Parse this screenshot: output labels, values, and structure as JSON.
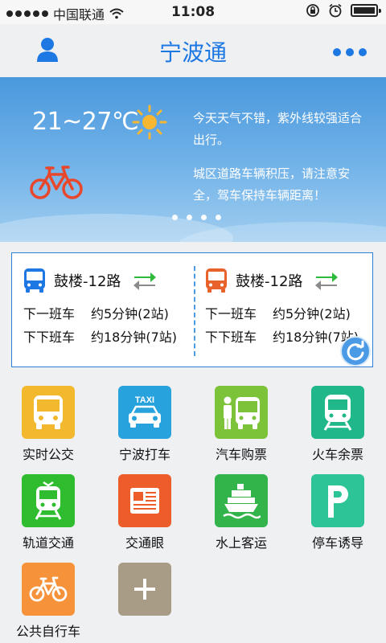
{
  "status_bar": {
    "carrier": "中国联通",
    "time": "11:08"
  },
  "header": {
    "title": "宁波通",
    "user_icon": "user-icon",
    "more_icon": "more-dots-icon"
  },
  "banner": {
    "temperature": "21~27℃",
    "weather_icon": "sun-icon",
    "transport_icon": "bicycle-icon",
    "notice_weather": "今天天气不错，紫外线较强适合出行。",
    "notice_traffic": "城区道路车辆积压，请注意安全，驾车保持车辆距离！",
    "page_count": 4,
    "active_page": 1
  },
  "bus_card": {
    "left": {
      "route": "鼓楼-12路",
      "next_label": "下一班车",
      "next_value": "约5分钟(2站)",
      "after_label": "下下班车",
      "after_value": "约18分钟(7站)",
      "bus_color": "#1e78e4"
    },
    "right": {
      "route": "鼓楼-12路",
      "next_label": "下一班车",
      "next_value": "约5分钟(2站)",
      "after_label": "下下班车",
      "after_value": "约18分钟(7站)",
      "bus_color": "#e8622b"
    }
  },
  "grid": {
    "items": [
      {
        "label": "实时公交",
        "icon": "bus-icon",
        "color": "#f3b92e"
      },
      {
        "label": "宁波打车",
        "icon": "taxi-icon",
        "color": "#27a2dc"
      },
      {
        "label": "汽车购票",
        "icon": "coach-ticket-icon",
        "color": "#7cc33a"
      },
      {
        "label": "火车余票",
        "icon": "train-icon",
        "color": "#20b78a"
      },
      {
        "label": "轨道交通",
        "icon": "metro-icon",
        "color": "#2fbd2f"
      },
      {
        "label": "交通眼",
        "icon": "newspaper-icon",
        "color": "#ec5d2a"
      },
      {
        "label": "水上客运",
        "icon": "ship-icon",
        "color": "#33b44a"
      },
      {
        "label": "停车诱导",
        "icon": "parking-icon",
        "color": "#2dc497"
      },
      {
        "label": "公共自行车",
        "icon": "bicycle-icon",
        "color": "#f6923a"
      },
      {
        "label": "",
        "icon": "add-icon",
        "color": "#a89c86"
      }
    ]
  }
}
